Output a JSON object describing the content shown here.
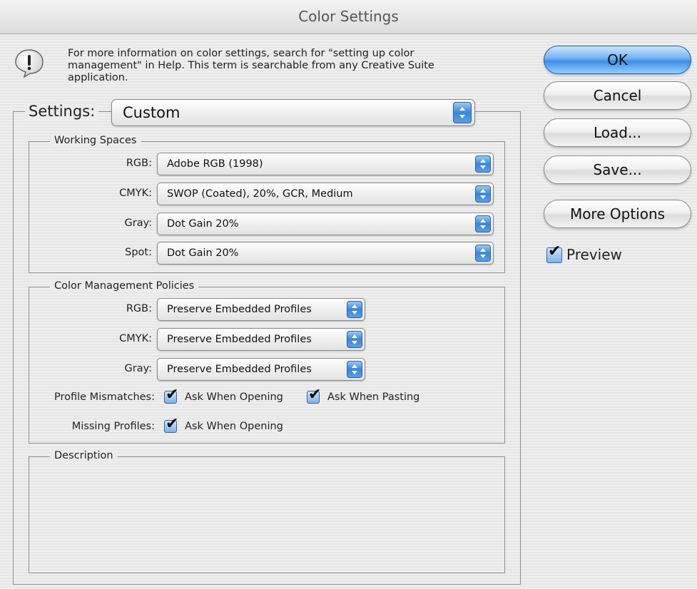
{
  "window": {
    "title": "Color Settings"
  },
  "info": {
    "icon": "alert-icon",
    "text": "For more information on color settings, search for \"setting up color management\" in Help. This term is searchable from any Creative Suite application."
  },
  "settings": {
    "label": "Settings:",
    "value": "Custom"
  },
  "working_spaces": {
    "title": "Working Spaces",
    "rows": [
      {
        "label": "RGB:",
        "value": "Adobe RGB (1998)"
      },
      {
        "label": "CMYK:",
        "value": "SWOP (Coated), 20%, GCR, Medium"
      },
      {
        "label": "Gray:",
        "value": "Dot Gain 20%"
      },
      {
        "label": "Spot:",
        "value": "Dot Gain 20%"
      }
    ]
  },
  "policies": {
    "title": "Color Management Policies",
    "rows": [
      {
        "label": "RGB:",
        "value": "Preserve Embedded Profiles"
      },
      {
        "label": "CMYK:",
        "value": "Preserve Embedded Profiles"
      },
      {
        "label": "Gray:",
        "value": "Preserve Embedded Profiles"
      }
    ],
    "profile_mismatches": {
      "label": "Profile Mismatches:",
      "ask_when_opening": {
        "label": "Ask When Opening",
        "checked": true
      },
      "ask_when_pasting": {
        "label": "Ask When Pasting",
        "checked": true
      }
    },
    "missing_profiles": {
      "label": "Missing Profiles:",
      "ask_when_opening": {
        "label": "Ask When Opening",
        "checked": true
      }
    }
  },
  "description": {
    "title": "Description"
  },
  "buttons": {
    "ok": "OK",
    "cancel": "Cancel",
    "load": "Load...",
    "save": "Save...",
    "more_options": "More Options"
  },
  "preview": {
    "label": "Preview",
    "checked": true
  },
  "colors": {
    "accent": "#3e8ee6",
    "default_button": "#6fb1f2"
  }
}
